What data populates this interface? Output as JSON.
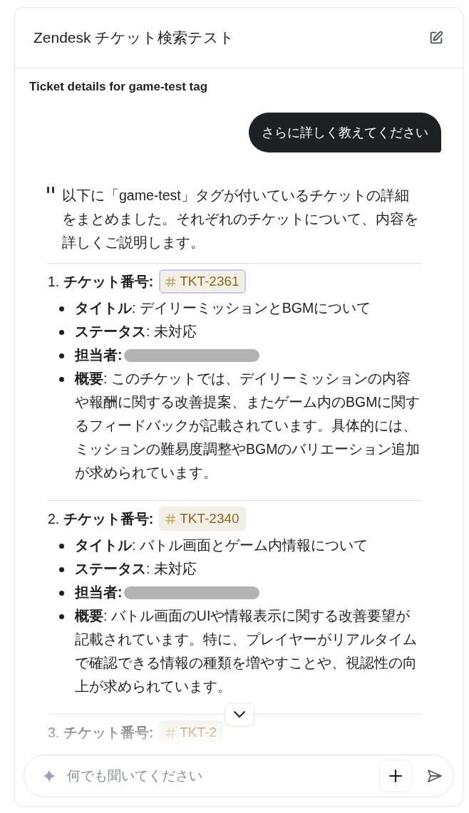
{
  "header": {
    "title": "Zendesk チケット検索テスト"
  },
  "subtitle": "Ticket details for game-test tag",
  "user_message": "さらに詳しく教えてください",
  "reply": {
    "intro": "以下に「game-test」タグが付いているチケットの詳細をまとめました。それぞれのチケットについて、内容を詳しくご説明します。",
    "tickets": [
      {
        "heading": "1. **チケット番号:**",
        "tag": "TKT-2361",
        "selected": true,
        "fields": [
          {
            "kind": "text",
            "text": "**タイトル**: デイリーミッションとBGMについて"
          },
          {
            "kind": "text",
            "text": "**ステータス**: 未対応"
          },
          {
            "kind": "redacted",
            "text": "**担当者:**"
          },
          {
            "kind": "text",
            "text": "**概要**: このチケットでは、デイリーミッションの内容や報酬に関する改善提案、またゲーム内のBGMに関するフィードバックが記載されています。具体的には、ミッションの難易度調整やBGMのバリエーション追加が求められています。"
          }
        ]
      },
      {
        "heading": "2. **チケット番号:**",
        "tag": "TKT-2340",
        "selected": false,
        "fields": [
          {
            "kind": "text",
            "text": "**タイトル**: バトル画面とゲーム内情報について"
          },
          {
            "kind": "text",
            "text": "**ステータス**: 未対応"
          },
          {
            "kind": "redacted",
            "text": "**担当者:**"
          },
          {
            "kind": "text",
            "text": "**概要**: バトル画面のUIや情報表示に関する改善要望が記載されています。特に、プレイヤーがリアルタイムで確認できる情報の種類を増やすことや、視認性の向上が求められています。"
          }
        ]
      },
      {
        "heading": "3. **チケット番号:**",
        "tag": "TKT-2",
        "selected": false
      }
    ]
  },
  "composer": {
    "placeholder": "何でも聞いてください"
  }
}
